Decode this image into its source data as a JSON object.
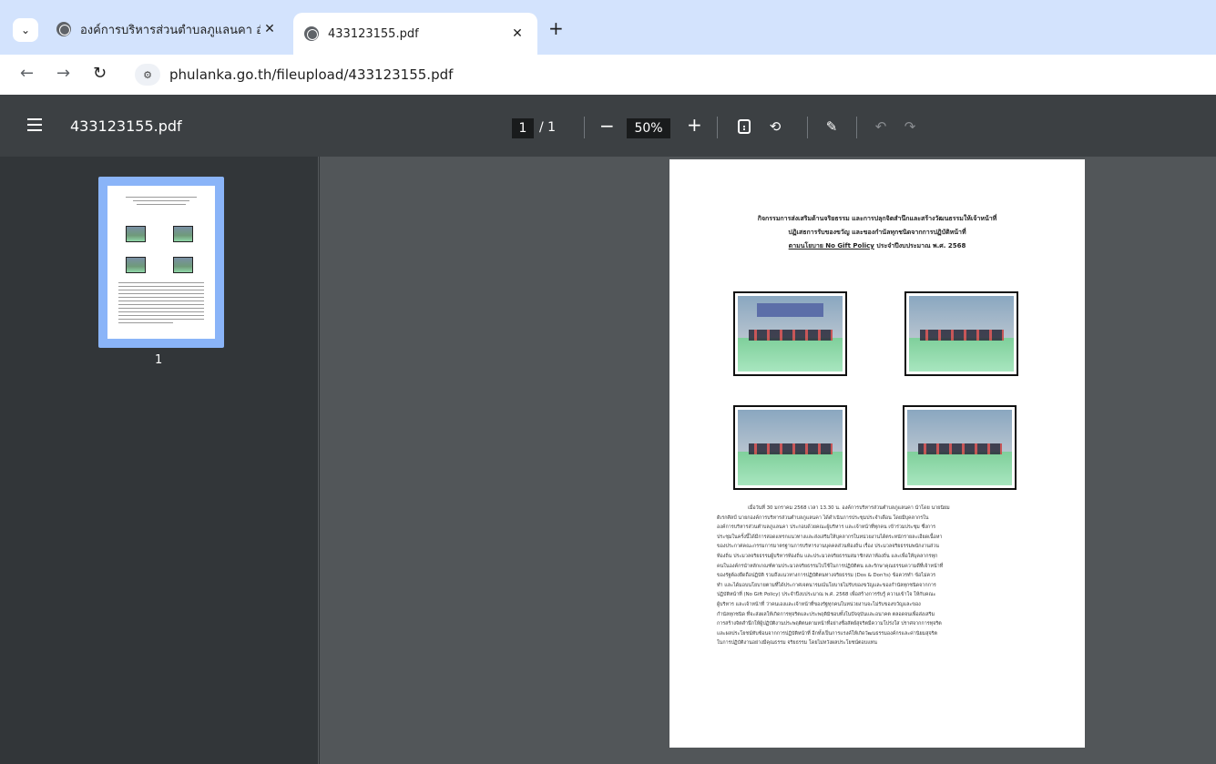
{
  "browser": {
    "tabs": [
      {
        "title": "องค์การบริหารส่วนตำบลภูแลนคา อำเ",
        "active": false
      },
      {
        "title": "433123155.pdf",
        "active": true
      }
    ],
    "url": "phulanka.go.th/fileupload/433123155.pdf"
  },
  "pdf_toolbar": {
    "file_name": "433123155.pdf",
    "current_page": "1",
    "total_pages": "/ 1",
    "zoom": "50%",
    "zoom_out": "−",
    "zoom_in": "+"
  },
  "sidebar": {
    "thumbnail_label": "1"
  },
  "document": {
    "heading_line1": "กิจกรรมการส่งเสริมด้านจริยธรรม และการปลุกจิตสำนึกและสร้างวัฒนธรรมให้เจ้าหน้าที่",
    "heading_line2": "ปฏิเสธการรับของขวัญ และของกำนัลทุกชนิดจากการปฏิบัติหน้าที่",
    "heading_line3_underlined": "ตามนโยบาย No Gift Policy",
    "heading_line3_rest": " ประจำปีงบประมาณ พ.ศ. 2568",
    "body_lines": [
      "เมื่อวันที่ 30 มกราคม 2568 เวลา 13.30 น. องค์การบริหารส่วนตำบลภูแลนคา นำโดย นายนิยม",
      "ดิเรกศิลป์ นายกองค์การบริหารส่วนตำบลภูแลนคา ได้ดำเนินการประชุมประจำเดือน โดยมีบุคลากรใน",
      "องค์การบริหารส่วนตำบลภูแลนคา ประกอบด้วยคณะผู้บริหาร และเจ้าหน้าที่ทุกคน เข้าร่วมประชุม ซึ่งการ",
      "ประชุมในครั้งนี้ได้มีการสอดแทรกแนวทางและส่งเสริมให้บุคลากรในหน่วยงานได้ตระหนักรายละเอียดเนื้อหา",
      "ของประกาศคณะกรรมการมาตรฐานการบริหารงานบุคคลส่วนท้องถิ่น เรื่อง ประมวลจริยธรรมพนักงานส่วน",
      "ท้องถิ่น ประมวลจริยธรรมผู้บริหารท้องถิ่น และประมวลจริยธรรมสมาชิกสภาท้องถิ่น และเพื่อให้บุคลากรทุก",
      "คนในองค์กรนำหลักเกณฑ์ตามประมวลจริยธรรมไปใช้ในการปฏิบัติตน และรักษาคุณธรรมความดีที่เจ้าหน้าที่",
      "ของรัฐต้องยึดถือปฏิบัติ รวมถึงแนวทางการปฏิบัติตนทางจริยธรรม (Dos & Don'ts) ข้อควรทำ ข้อไม่ควร",
      "ทำ และได้มอบนโยบายตามที่ได้ประกาศเจตนารมณ์นโยบายไม่รับของขวัญและของกำนัลทุกชนิดจากการ",
      "ปฏิบัติหน้าที่ (No Gift Policy) ประจำปีงบประมาณ พ.ศ. 2568 เพื่อสร้างการรับรู้ ความเข้าใจ ให้กับคณะ",
      "ผู้บริหาร และเจ้าหน้าที่ ว่าคนเองและเจ้าหน้าที่ของรัฐทุกคนในหน่วยงานจะไม่รับของขวัญและของ",
      "กำนัลทุกชนิด ที่จะส่งผลให้เกิดการทุจริตและประพฤติมิชอบทั้งในปัจจุบันและอนาคต ตลอดจนเพื่อส่งเสริม",
      "การสร้างจิตสำนึกให้ผู้ปฏิบัติงานประพฤติตนตามหน้าที่อย่างซื่อสัตย์สุจริตมีความโปร่งใส ปราศจากการทุจริต",
      "และผลประโยชน์ทับซ้อนจากการปฏิบัติหน้าที่ อีกทั้งเป็นการแรงค์ให้เกิดวัฒนธรรมองค์กรและค่านิยมสุจริต",
      "ในการปฏิบัติงานอย่างมีคุณธรรม จริยธรรม โดยไม่หวังผลประโยชน์ตอบแทน"
    ]
  }
}
